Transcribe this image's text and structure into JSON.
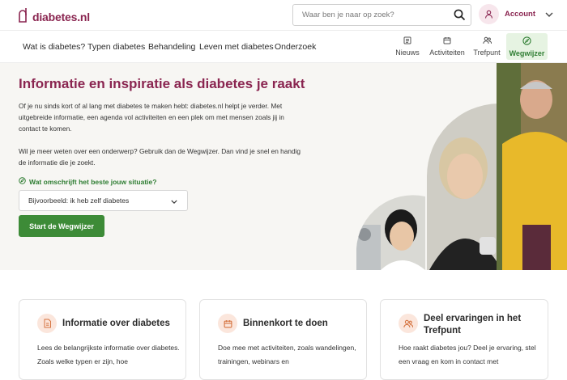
{
  "header": {
    "logo_text": "diabetes.nl",
    "search_placeholder": "Waar ben je naar op zoek?",
    "account_label": "Account"
  },
  "nav": {
    "links": [
      "Wat is diabetes?",
      "Typen diabetes",
      "Behandeling",
      "Leven met diabetes",
      "Onderzoek"
    ],
    "quick_links": [
      {
        "label": "Nieuws",
        "icon": "news-icon"
      },
      {
        "label": "Activiteiten",
        "icon": "calendar-icon"
      },
      {
        "label": "Trefpunt",
        "icon": "people-icon"
      },
      {
        "label": "Wegwijzer",
        "icon": "compass-icon",
        "active": true
      }
    ]
  },
  "hero": {
    "title": "Informatie en inspiratie als diabetes je raakt",
    "paragraph1": "Of je nu sinds kort of al lang met diabetes te maken hebt: diabetes.nl helpt je verder. Met uitgebreide informatie, een agenda vol activiteiten en een plek om met mensen zoals jij in contact te komen.",
    "paragraph2": "Wil je meer weten over een onderwerp? Gebruik dan de Wegwijzer. Dan vind je snel en handig de informatie die je zoekt.",
    "question": "Wat omschrijft het beste jouw situatie?",
    "select_value": "Bijvoorbeeld: ik heb zelf diabetes",
    "button_label": "Start de Wegwijzer"
  },
  "cards": [
    {
      "title": "Informatie over diabetes",
      "text": "Lees de belangrijkste informatie over diabetes. Zoals welke typen er zijn, hoe",
      "icon": "document-icon"
    },
    {
      "title": "Binnenkort te doen",
      "text": "Doe mee met activiteiten, zoals wandelingen, trainingen, webinars en",
      "icon": "calendar-icon"
    },
    {
      "title": "Deel ervaringen in het Trefpunt",
      "text": "Hoe raakt diabetes jou? Deel je ervaring, stel een vraag en kom in contact met",
      "icon": "people-icon"
    }
  ],
  "colors": {
    "brand": "#8a2550",
    "green": "#3d8b37",
    "hero_bg": "#f7f6f3",
    "card_icon_bg": "#fbe6dc"
  }
}
